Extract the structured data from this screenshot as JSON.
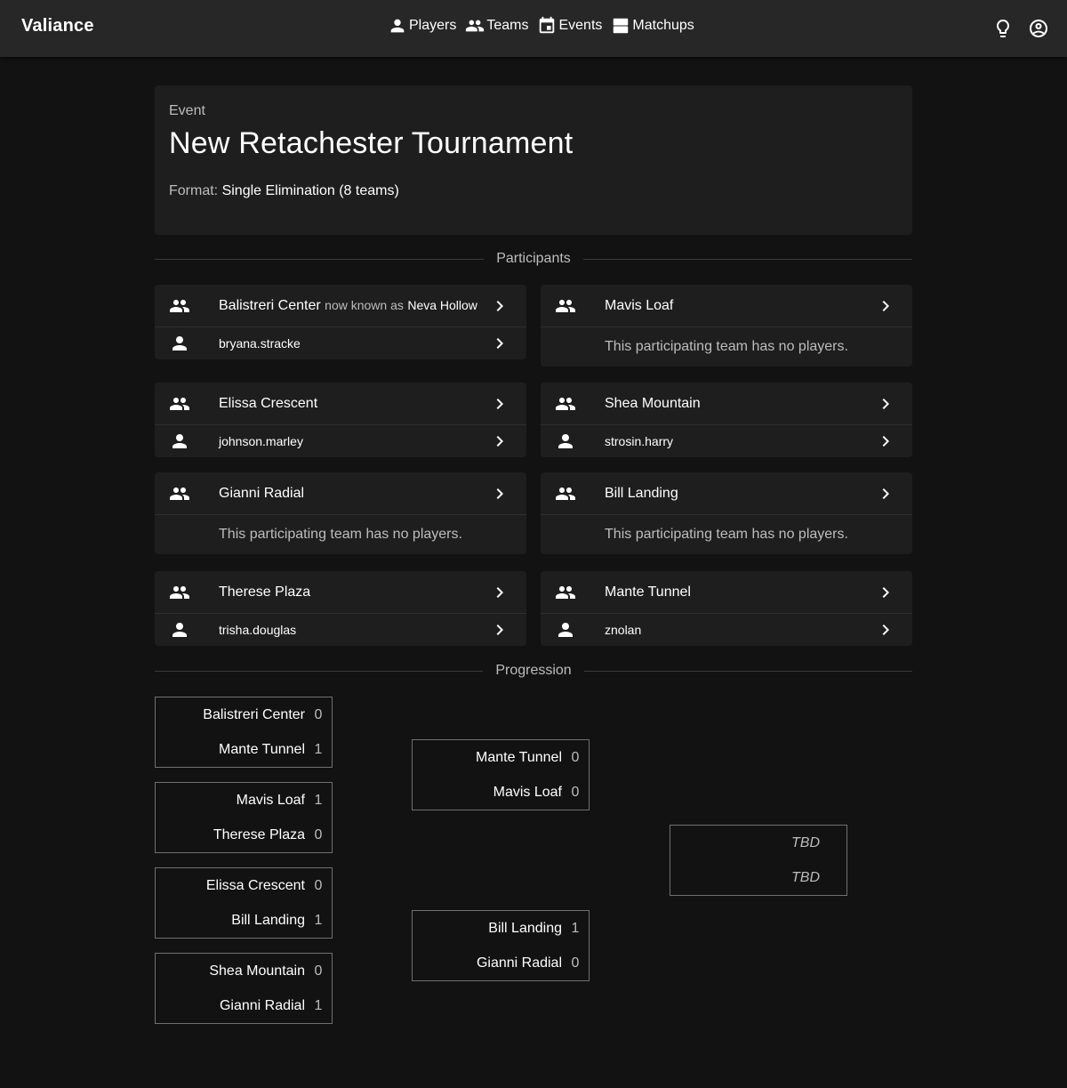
{
  "app": {
    "name": "Valiance"
  },
  "nav": {
    "players": "Players",
    "teams": "Teams",
    "events": "Events",
    "matchups": "Matchups"
  },
  "event": {
    "overline": "Event",
    "title": "New Retachester Tournament",
    "format_label": "Format:",
    "format_value": "Single Elimination (8 teams)"
  },
  "sections": {
    "participants": "Participants",
    "progression": "Progression"
  },
  "participants": [
    {
      "team": "Balistreri Center",
      "aka_label": "now known as",
      "aka_name": "Neva Hollow",
      "player": "bryana.stracke"
    },
    {
      "team": "Mavis Loaf",
      "empty": "This participating team has no players."
    },
    {
      "team": "Elissa Crescent",
      "player": "johnson.marley"
    },
    {
      "team": "Shea Mountain",
      "player": "strosin.harry"
    },
    {
      "team": "Gianni Radial",
      "empty": "This participating team has no players."
    },
    {
      "team": "Bill Landing",
      "empty": "This participating team has no players."
    },
    {
      "team": "Therese Plaza",
      "player": "trisha.douglas"
    },
    {
      "team": "Mante Tunnel",
      "player": "znolan"
    }
  ],
  "bracket": {
    "round1": [
      {
        "a": "Balistreri Center",
        "a_score": "0",
        "b": "Mante Tunnel",
        "b_score": "1"
      },
      {
        "a": "Mavis Loaf",
        "a_score": "1",
        "b": "Therese Plaza",
        "b_score": "0"
      },
      {
        "a": "Elissa Crescent",
        "a_score": "0",
        "b": "Bill Landing",
        "b_score": "1"
      },
      {
        "a": "Shea Mountain",
        "a_score": "0",
        "b": "Gianni Radial",
        "b_score": "1"
      }
    ],
    "round2": [
      {
        "a": "Mante Tunnel",
        "a_score": "0",
        "b": "Mavis Loaf",
        "b_score": "0"
      },
      {
        "a": "Bill Landing",
        "a_score": "1",
        "b": "Gianni Radial",
        "b_score": "0"
      }
    ],
    "final": {
      "a": "TBD",
      "b": "TBD"
    }
  }
}
